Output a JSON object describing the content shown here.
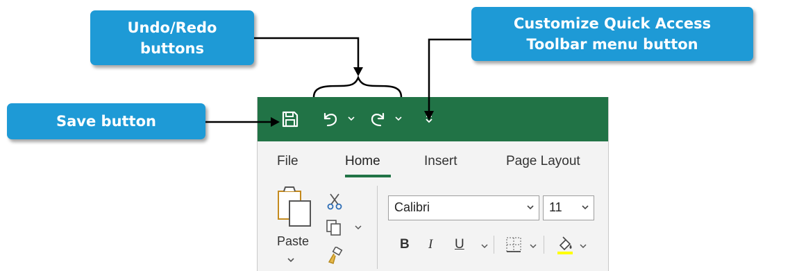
{
  "callouts": {
    "undo_redo": [
      "Undo/Redo",
      "buttons"
    ],
    "customize_qat": [
      "Customize Quick Access",
      "Toolbar menu button"
    ],
    "save": [
      "Save button"
    ]
  },
  "colors": {
    "callout_bg": "#1e9ad6",
    "title_bar": "#217346",
    "accent_underline": "#217346",
    "highlight_yellow": "#ffff00"
  },
  "qat": {
    "icons": [
      "save-icon",
      "undo-icon",
      "redo-icon",
      "customize-qat-icon"
    ]
  },
  "tabs": [
    "File",
    "Home",
    "Insert",
    "Page Layout"
  ],
  "active_tab": "Home",
  "clipboard": {
    "paste_label": "Paste"
  },
  "font": {
    "name": "Calibri",
    "size": "11"
  },
  "format_buttons": {
    "bold": "B",
    "italic": "I",
    "underline": "U"
  }
}
